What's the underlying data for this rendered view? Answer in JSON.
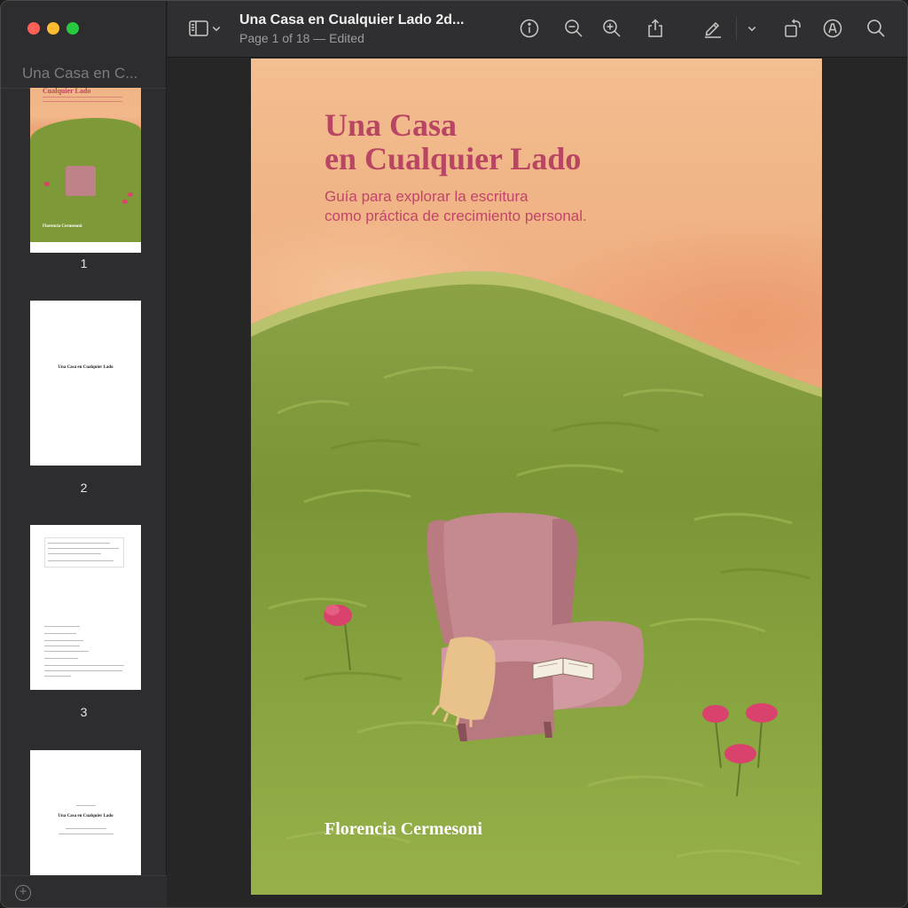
{
  "window": {
    "sidebar_title": "Una Casa en C...",
    "doc_title": "Una Casa en Cualquier Lado 2d...",
    "doc_subtitle": "Page 1 of 18 — Edited"
  },
  "toolbar": {
    "icons": [
      "sidebar-icon",
      "chevron-down-icon",
      "info-icon",
      "zoom-out-icon",
      "zoom-in-icon",
      "share-icon",
      "markup-pen-icon",
      "chevron-down-icon",
      "rotate-icon",
      "annotate-icon",
      "search-icon"
    ]
  },
  "thumbnails": [
    {
      "number": "1",
      "title": "Una Casa en Cualquier Lado",
      "author": "Florencia Cermesoni"
    },
    {
      "number": "2",
      "title": "Una Casa en Cualquier Lado"
    },
    {
      "number": "3"
    },
    {
      "number": "",
      "title": "Una Casa en Cualquier Lado"
    }
  ],
  "cover": {
    "title_line1": "Una Casa",
    "title_line2": "en Cualquier Lado",
    "subtitle_line1": "Guía para explorar la escritura",
    "subtitle_line2": "como práctica de crecimiento personal.",
    "author": "Florencia Cermesoni"
  },
  "colors": {
    "title": "#b84562",
    "subtitle": "#c1456a",
    "sky": "#f0b486",
    "grass": "#7e9a38",
    "chair": "#c08289"
  }
}
